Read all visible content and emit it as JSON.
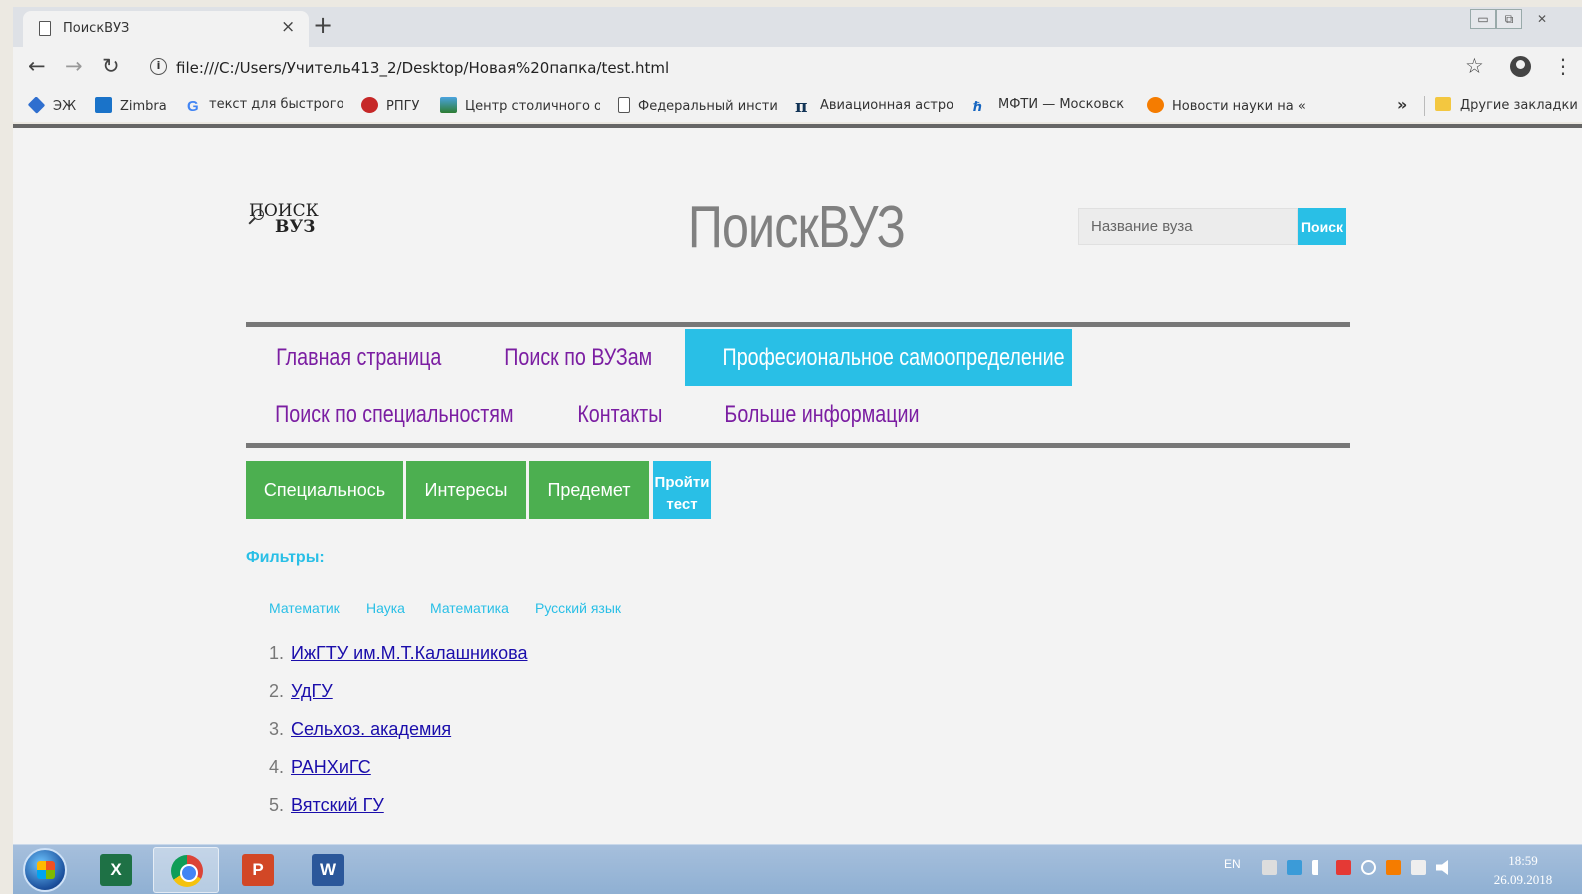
{
  "browser": {
    "tab_title": "ПоискВУЗ",
    "tab_close": "×",
    "new_tab": "+",
    "url": "file:///C:/Users/Учитель413_2/Desktop/Новая%20папка/test.html",
    "bookmarks": [
      {
        "label": "ЭЖ",
        "icon": "book-stack-icon",
        "color": "#2f6fcf"
      },
      {
        "label": "Zimbra",
        "icon": "zimbra-icon",
        "color": "#1a73c9"
      },
      {
        "label": "текст для быстрого",
        "icon": "google-icon",
        "color": "#4285f4"
      },
      {
        "label": "РПГУ",
        "icon": "rpgu-icon",
        "color": "#c62828"
      },
      {
        "label": "Центр столичного о",
        "icon": "center-icon",
        "color": "#3f6ea8"
      },
      {
        "label": "Федеральный инсти",
        "icon": "page-icon",
        "color": "#ffffff"
      },
      {
        "label": "Авиационная астро",
        "icon": "pi-icon",
        "color": "#123456"
      },
      {
        "label": "МФТИ — Московск",
        "icon": "mipt-icon",
        "color": "#1565c0"
      },
      {
        "label": "Новости науки на «",
        "icon": "science-news-icon",
        "color": "#f57c00"
      }
    ],
    "more_bookmarks": "»",
    "other_bookmarks": "Другие закладки"
  },
  "page": {
    "logo_line1": "ПОИСК",
    "logo_line2": "ВУЗ",
    "site_title": "ПоискВУЗ",
    "search_placeholder": "Название вуза",
    "search_button": "Поиск",
    "menu": [
      "Главная страница",
      "Поиск по ВУЗам",
      "Професиональное самоопределение",
      "Поиск по специальностям",
      "Контакты",
      "Больше информации"
    ],
    "sub_buttons": [
      "Специальнось",
      "Интересы",
      "Предемет"
    ],
    "test_button": {
      "line1": "Пройти",
      "line2": "тест"
    },
    "filters_label": "Фильтры:",
    "filter_chips": [
      "Математик",
      "Наука",
      "Математика",
      "Русский язык"
    ],
    "universities": [
      {
        "num": "1.",
        "name": "ИжГТУ им.М.Т.Калашникова"
      },
      {
        "num": "2.",
        "name": "УдГУ"
      },
      {
        "num": "3.",
        "name": "Сельхоз. академия"
      },
      {
        "num": "4.",
        "name": "РАНХиГС"
      },
      {
        "num": "5.",
        "name": "Вятский ГУ"
      }
    ]
  },
  "taskbar": {
    "apps": [
      "excel",
      "chrome",
      "powerpoint",
      "word"
    ],
    "lang": "EN",
    "time": "18:59",
    "date": "26.09.2018"
  },
  "colors": {
    "accent_cyan": "#29bfe6",
    "menu_purple": "#7b1ea2",
    "button_green": "#4caf50",
    "link_blue": "#1a0dab"
  }
}
